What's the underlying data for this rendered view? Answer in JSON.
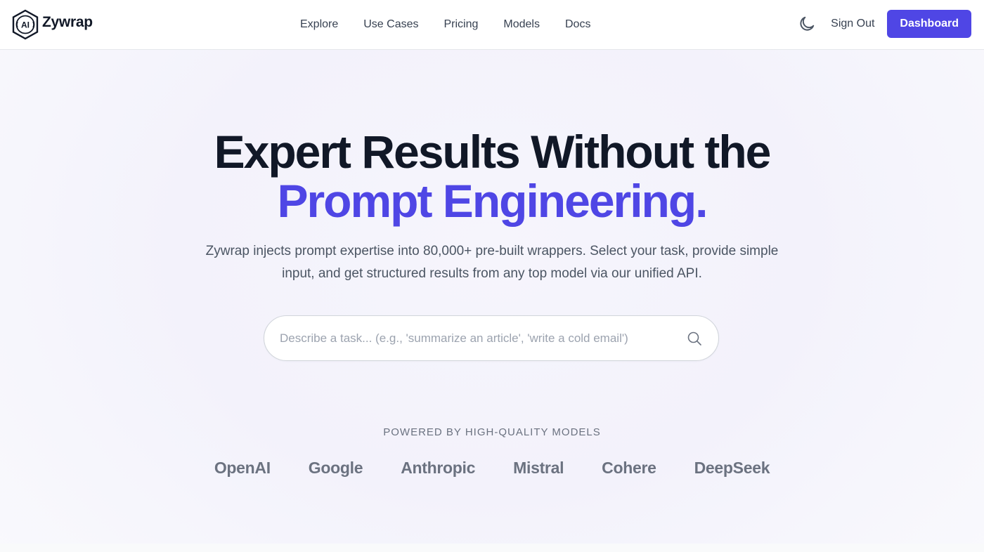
{
  "brand": {
    "name": "Zywrap",
    "logo_icon": "ai-brain-hexagon-icon",
    "logo_text": "AI"
  },
  "nav": {
    "links": [
      "Explore",
      "Use Cases",
      "Pricing",
      "Models",
      "Docs"
    ],
    "theme_toggle_icon": "moon-icon",
    "sign_out": "Sign Out",
    "dashboard": "Dashboard"
  },
  "hero": {
    "headline_line1": "Expert Results Without the",
    "headline_line2": "Prompt Engineering.",
    "subtext": "Zywrap injects prompt expertise into 80,000+ pre-built wrappers. Select your task, provide simple input, and get structured results from any top model via our unified API.",
    "search": {
      "placeholder": "Describe a task... (e.g., 'summarize an article', 'write a cold email')",
      "value": "",
      "icon": "search-icon"
    },
    "powered_by": "POWERED BY HIGH-QUALITY MODELS",
    "models": [
      "OpenAI",
      "Google",
      "Anthropic",
      "Mistral",
      "Cohere",
      "DeepSeek"
    ]
  },
  "colors": {
    "accent": "#4f46e5",
    "text_dark": "#111827",
    "text_muted": "#6b7280",
    "hero_bg": "#f4f3fb"
  }
}
